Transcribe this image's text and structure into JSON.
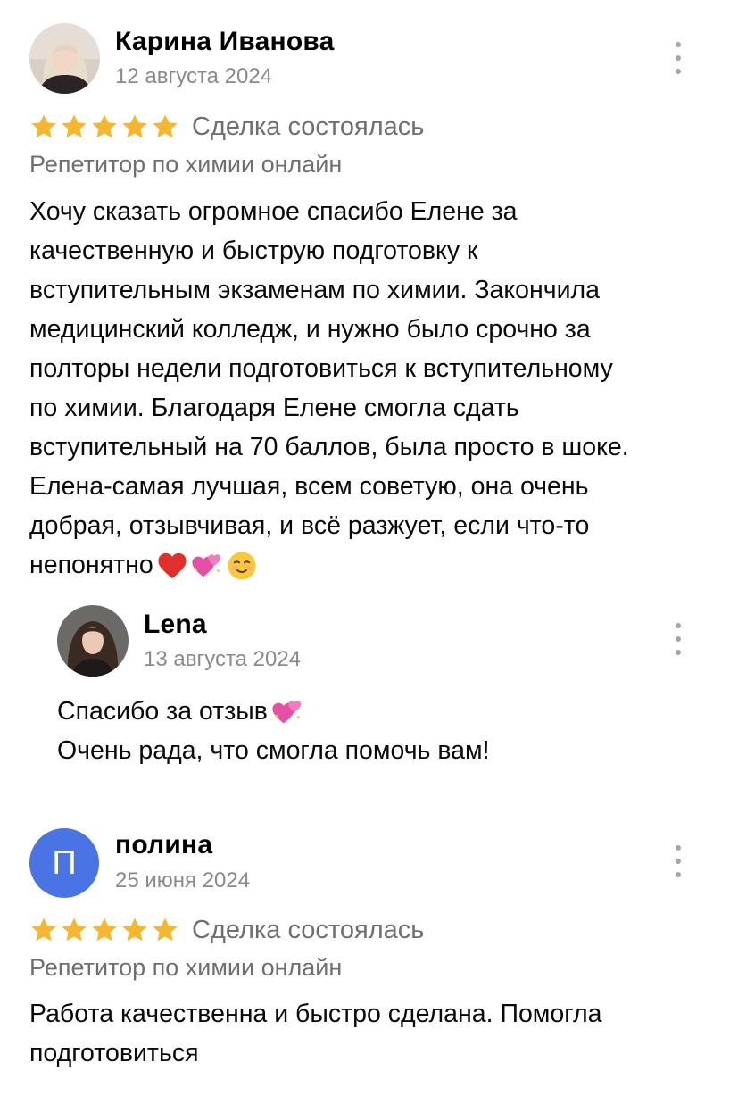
{
  "reviews": [
    {
      "author": "Карина Иванова",
      "date": "12 августа 2024",
      "rating": 5,
      "deal_status": "Сделка состоялась",
      "category": "Репетитор по химии онлайн",
      "text_lines": [
        "Хочу сказать огромное спасибо Елене за",
        "качественную и быструю подготовку к",
        "вступительным экзаменам по химии. Закончила",
        "медицинский колледж, и нужно было срочно за",
        "полторы недели подготовиться к вступительному",
        "по химии. Благодаря Елене смогла сдать",
        "вступительный на 70 баллов, была просто в шоке.",
        "Елена-самая лучшая, всем советую, она очень",
        "добрая, отзывчивая, и всё разжует, если что-то",
        "непонятно"
      ],
      "text_emojis": [
        "red-heart-icon",
        "two-hearts-icon",
        "smiling-face-icon"
      ],
      "reply": {
        "author": "Lena",
        "date": "13 августа 2024",
        "text_lines": [
          "Спасибо за отзыв",
          "Очень рада, что смогла помочь вам!"
        ],
        "text_emojis": [
          "two-hearts-icon"
        ]
      }
    },
    {
      "author": "полина",
      "avatar_letter": "П",
      "avatar_color": "#4a73e3",
      "date": "25 июня 2024",
      "rating": 5,
      "deal_status": "Сделка состоялась",
      "category": "Репетитор по химии онлайн",
      "text_lines": [
        "Работа качественна и быстро сделана. Помогла",
        "подготовиться"
      ]
    }
  ],
  "colors": {
    "star": "#f5b731",
    "secondary_text": "#6f6f6f",
    "date_text": "#8a8a8a",
    "menu_dots": "#a6a6a6"
  }
}
